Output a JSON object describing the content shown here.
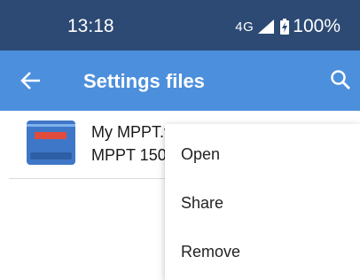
{
  "status_bar": {
    "time": "13:18",
    "network": "4G",
    "battery_percent": "100%",
    "icons": [
      "signal-icon",
      "battery-icon"
    ]
  },
  "app_bar": {
    "title": "Settings files",
    "icons": [
      "back-arrow-icon",
      "search-icon"
    ],
    "color": "#4c8fdd"
  },
  "files": [
    {
      "name": "My MPPT.v",
      "model": "MPPT 150"
    }
  ],
  "context_menu": {
    "items": [
      "Open",
      "Share",
      "Remove"
    ]
  },
  "colors": {
    "status_bar": "#2c4a73",
    "app_bar": "#4c8fdd",
    "menu_bg": "#ffffff"
  }
}
